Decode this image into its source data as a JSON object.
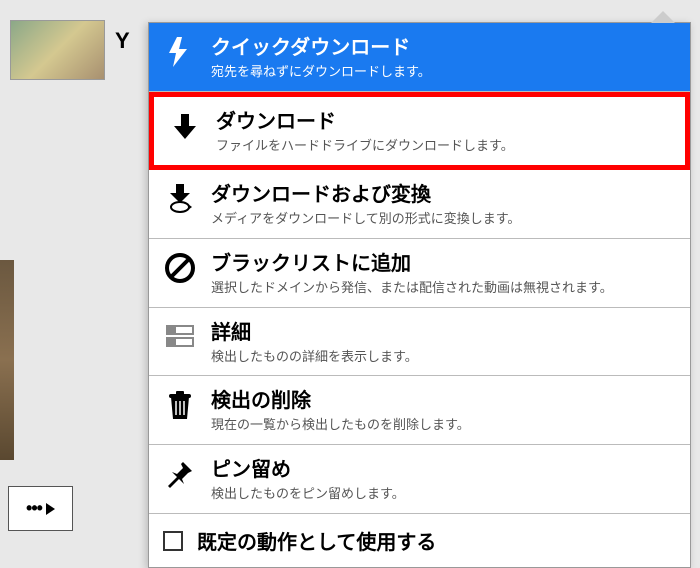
{
  "left": {
    "title_fragment": "Y"
  },
  "menu": {
    "items": [
      {
        "title": "クイックダウンロード",
        "desc": "宛先を尋ねずにダウンロードします。"
      },
      {
        "title": "ダウンロード",
        "desc": "ファイルをハードドライブにダウンロードします。"
      },
      {
        "title": "ダウンロードおよび変換",
        "desc": "メディアをダウンロードして別の形式に変換します。"
      },
      {
        "title": "ブラックリストに追加",
        "desc": "選択したドメインから発信、または配信された動画は無視されます。"
      },
      {
        "title": "詳細",
        "desc": "検出したものの詳細を表示します。"
      },
      {
        "title": "検出の削除",
        "desc": "現在の一覧から検出したものを削除します。"
      },
      {
        "title": "ピン留め",
        "desc": "検出したものをピン留めします。"
      }
    ],
    "default_label": "既定の動作として使用する"
  },
  "more_button": {
    "dots": "•••"
  }
}
